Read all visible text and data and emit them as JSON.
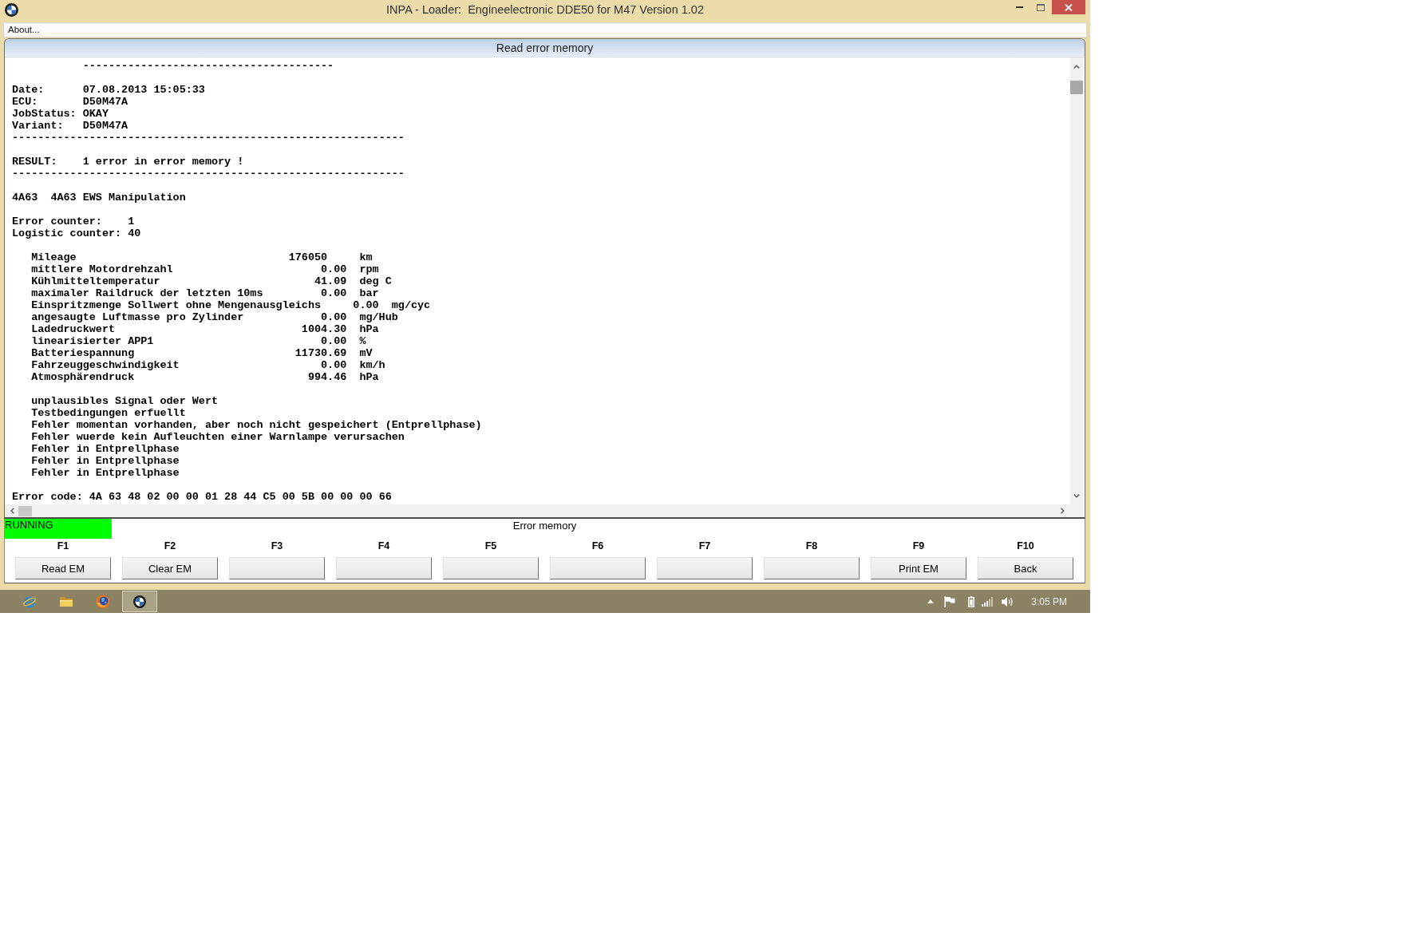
{
  "window": {
    "title": "INPA - Loader:  Engineelectronic DDE50 for M47 Version 1.02"
  },
  "menu": [
    {
      "label": "About..."
    }
  ],
  "panel": {
    "title": "Read error memory"
  },
  "report": {
    "top_rule": "---------------------------------------",
    "header": [
      {
        "label": "Date:",
        "value": "07.08.2013 15:05:33"
      },
      {
        "label": "ECU:",
        "value": "D50M47A"
      },
      {
        "label": "JobStatus:",
        "value": "OKAY"
      },
      {
        "label": "Variant:",
        "value": "D50M47A"
      }
    ],
    "rule_1": "-------------------------------------------------------------",
    "result": {
      "label": "RESULT:",
      "value": "1 error in error memory !"
    },
    "rule_2": "-------------------------------------------------------------",
    "error": {
      "code": "4A63",
      "description": "4A63 EWS Manipulation"
    },
    "counters": [
      {
        "label": "Error counter:",
        "value": "1"
      },
      {
        "label": "Logistic counter:",
        "value": "40"
      }
    ],
    "measurements": [
      {
        "name": "Mileage",
        "value": "176050",
        "unit": "km",
        "kind": "integer"
      },
      {
        "name": "mittlere Motordrehzahl",
        "value": "0.00",
        "unit": "rpm",
        "kind": "decimal"
      },
      {
        "name": "Kühlmitteltemperatur",
        "value": "41.09",
        "unit": "deg C",
        "kind": "decimal"
      },
      {
        "name": "maximaler Raildruck der letzten 10ms",
        "value": "0.00",
        "unit": "bar",
        "kind": "decimal"
      },
      {
        "name": "Einspritzmenge Sollwert ohne Mengenausgleichs",
        "value": "0.00",
        "unit": "mg/cyc",
        "kind": "decimal"
      },
      {
        "name": "angesaugte Luftmasse pro Zylinder",
        "value": "0.00",
        "unit": "mg/Hub",
        "kind": "decimal"
      },
      {
        "name": "Ladedruckwert",
        "value": "1004.30",
        "unit": "hPa",
        "kind": "decimal"
      },
      {
        "name": "linearisierter APP1",
        "value": "0.00",
        "unit": "%",
        "kind": "decimal"
      },
      {
        "name": "Batteriespannung",
        "value": "11730.69",
        "unit": "mV",
        "kind": "decimal"
      },
      {
        "name": "Fahrzeuggeschwindigkeit",
        "value": "0.00",
        "unit": "km/h",
        "kind": "decimal"
      },
      {
        "name": "Atmosphärendruck",
        "value": "994.46",
        "unit": "hPa",
        "kind": "decimal"
      }
    ],
    "conditions": [
      "unplausibles Signal oder Wert",
      "Testbedingungen erfuellt",
      "Fehler momentan vorhanden, aber noch nicht gespeichert (Entprellphase)",
      "Fehler wuerde kein Aufleuchten einer Warnlampe verursachen",
      "Fehler in Entprellphase",
      "Fehler in Entprellphase",
      "Fehler in Entprellphase"
    ],
    "error_code": {
      "label": "Error code:",
      "value": "4A 63 48 02 00 00 01 28 44 C5 00 5B 00 00 00 66"
    }
  },
  "status": {
    "text": "RUNNING"
  },
  "function_bar": {
    "title": "Error memory",
    "keys": [
      {
        "key": "F1",
        "label": "Read EM"
      },
      {
        "key": "F2",
        "label": "Clear EM"
      },
      {
        "key": "F3"
      },
      {
        "key": "F4"
      },
      {
        "key": "F5"
      },
      {
        "key": "F6"
      },
      {
        "key": "F7"
      },
      {
        "key": "F8"
      },
      {
        "key": "F9",
        "label": "Print EM"
      },
      {
        "key": "F10",
        "label": "Back"
      }
    ]
  },
  "taskbar": {
    "apps": [
      {
        "kind": "orbit",
        "selected": false
      },
      {
        "kind": "folder",
        "selected": false
      },
      {
        "kind": "globe",
        "selected": false
      },
      {
        "kind": "roundel",
        "selected": true
      }
    ],
    "clock": "3:05 PM"
  }
}
